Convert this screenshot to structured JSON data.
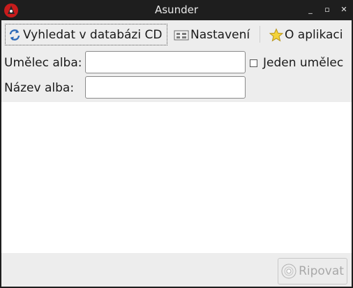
{
  "window": {
    "title": "Asunder",
    "controls": {
      "minimize": "_",
      "maximize": "▫",
      "close": "✕"
    }
  },
  "toolbar": {
    "search_cddb_label": "Vyhledat v databázi CD",
    "preferences_label": "Nastavení",
    "about_label": "O aplikaci"
  },
  "form": {
    "album_artist_label": "Umělec alba:",
    "album_artist_value": "",
    "album_title_label": "Název alba:",
    "album_title_value": "",
    "single_artist_label": "Jeden umělec",
    "single_artist_checked": false
  },
  "tracks": [],
  "actions": {
    "rip_label": "Ripovat",
    "rip_enabled": false
  },
  "icons": {
    "app": "asunder-app-icon",
    "search": "refresh-icon",
    "preferences": "preferences-icon",
    "about": "star-icon",
    "rip": "cd-icon"
  }
}
